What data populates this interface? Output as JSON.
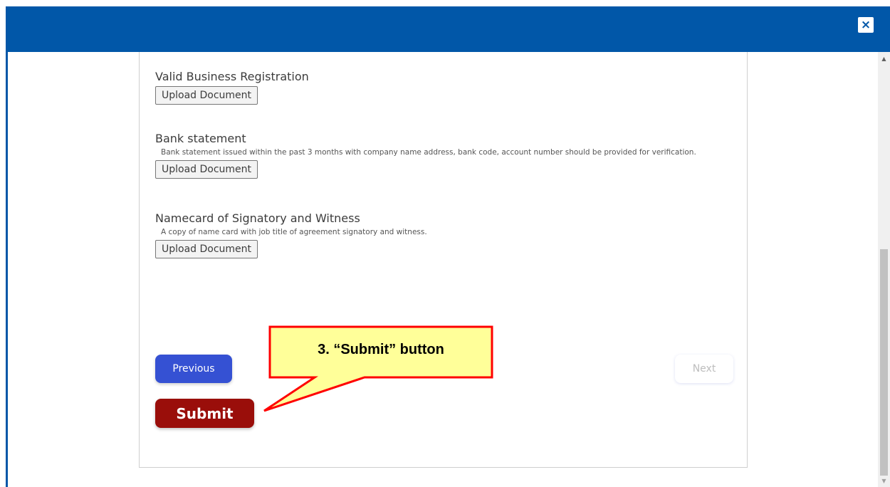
{
  "header": {
    "close_label": "×",
    "background_color": "#0157a8"
  },
  "documents": [
    {
      "title": "Valid Business Registration",
      "description": "",
      "upload_label": "Upload Document"
    },
    {
      "title": "Bank statement",
      "description": "Bank statement issued within the past 3 months with company name address, bank code, account number should be provided for verification.",
      "upload_label": "Upload Document"
    },
    {
      "title": "Namecard of Signatory and Witness",
      "description": "A copy of name card with job title of agreement signatory and witness.",
      "upload_label": "Upload Document"
    }
  ],
  "navigation": {
    "previous_label": "Previous",
    "next_label": "Next",
    "submit_label": "Submit",
    "previous_color": "#3551d3",
    "submit_color": "#9a0e0a"
  },
  "callout": {
    "text": "3. “Submit” button",
    "fill_color": "#ffff99",
    "border_color": "#ff0000"
  },
  "icons": {
    "close": "close-icon",
    "scroll_up": "scroll-up-arrow-icon",
    "scroll_down": "scroll-down-arrow-icon"
  }
}
